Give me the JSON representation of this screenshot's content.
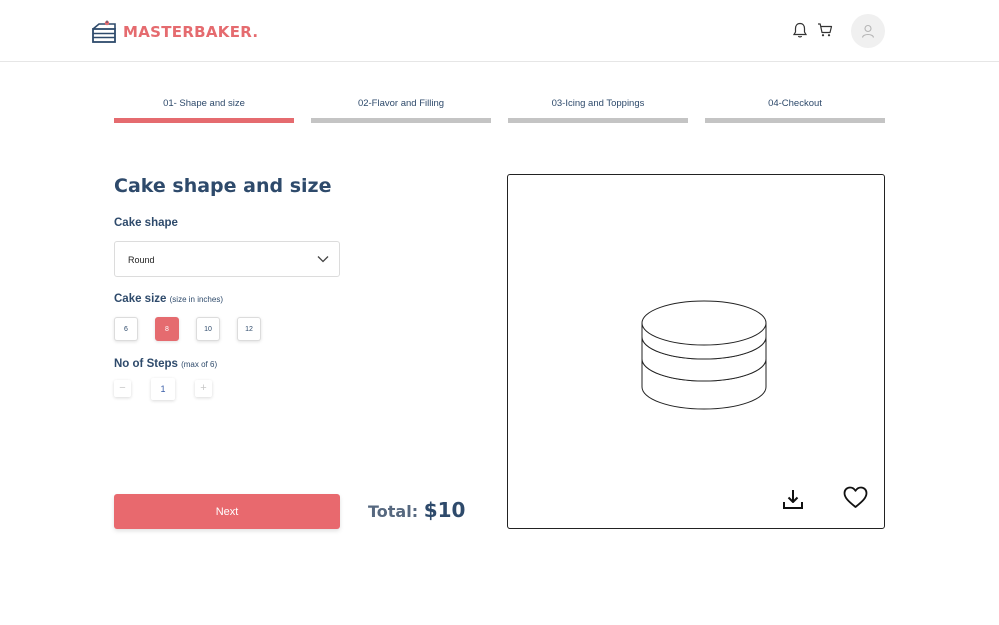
{
  "header": {
    "brand": "MASTERBAKER.",
    "icons": [
      "cake-logo-icon",
      "bell-icon",
      "cart-icon",
      "user-icon"
    ]
  },
  "steps": [
    {
      "label": "01- Shape and size",
      "active": true
    },
    {
      "label": "02-Flavor and Filling",
      "active": false
    },
    {
      "label": "03-Icing and Toppings",
      "active": false
    },
    {
      "label": "04-Checkout",
      "active": false
    }
  ],
  "form": {
    "title": "Cake shape and size",
    "shape_label": "Cake shape",
    "shape_value": "Round",
    "size_label": "Cake size",
    "size_hint": "(size in inches)",
    "sizes": [
      "6",
      "8",
      "10",
      "12"
    ],
    "selected_size": "8",
    "steps_label": "No of Steps",
    "steps_hint": "(max of 6)",
    "steps_minus": "−",
    "steps_value": "1",
    "steps_plus": "+"
  },
  "actions": {
    "next_label": "Next",
    "total_label": "Total:",
    "total_value": "$10"
  },
  "colors": {
    "brand": "#e56b6f",
    "text": "#2e4a6b",
    "inactive_bar": "#c4c4c4"
  }
}
